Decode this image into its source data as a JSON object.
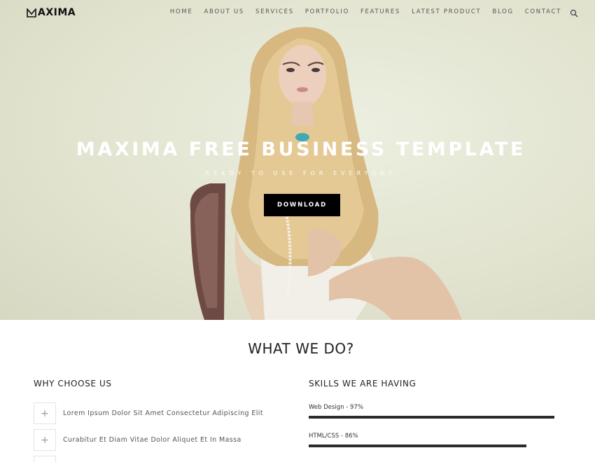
{
  "brand": {
    "name": "AXIMA"
  },
  "nav": {
    "items": [
      "HOME",
      "ABOUT US",
      "SERVICES",
      "PORTFOLIO",
      "FEATURES",
      "LATEST PRODUCT",
      "BLOG",
      "CONTACT"
    ],
    "search_icon": "search-icon"
  },
  "hero": {
    "title": "MAXIMA FREE BUSINESS TEMPLATE",
    "subtitle": "READY TO USE FOR EVERYONE",
    "button_label": "DOWNLOAD"
  },
  "section": {
    "title": "WHAT WE DO?",
    "why": {
      "heading": "WHY CHOOSE US",
      "items": [
        "Lorem Ipsum Dolor Sit Amet Consectetur Adipiscing Elit",
        "Curabitur Et Diam Vitae Dolor Aliquet Et In Massa"
      ],
      "item_icon": "plus-icon"
    },
    "skills": {
      "heading": "SKILLS WE ARE HAVING",
      "items": [
        {
          "label": "Web Design - 97%",
          "percent": 97
        },
        {
          "label": "HTML/CSS - 86%",
          "percent": 86
        }
      ]
    }
  },
  "colors": {
    "accent": "#000000",
    "bar": "#2b2b2b",
    "hero_bg": "#e2e4d0"
  }
}
